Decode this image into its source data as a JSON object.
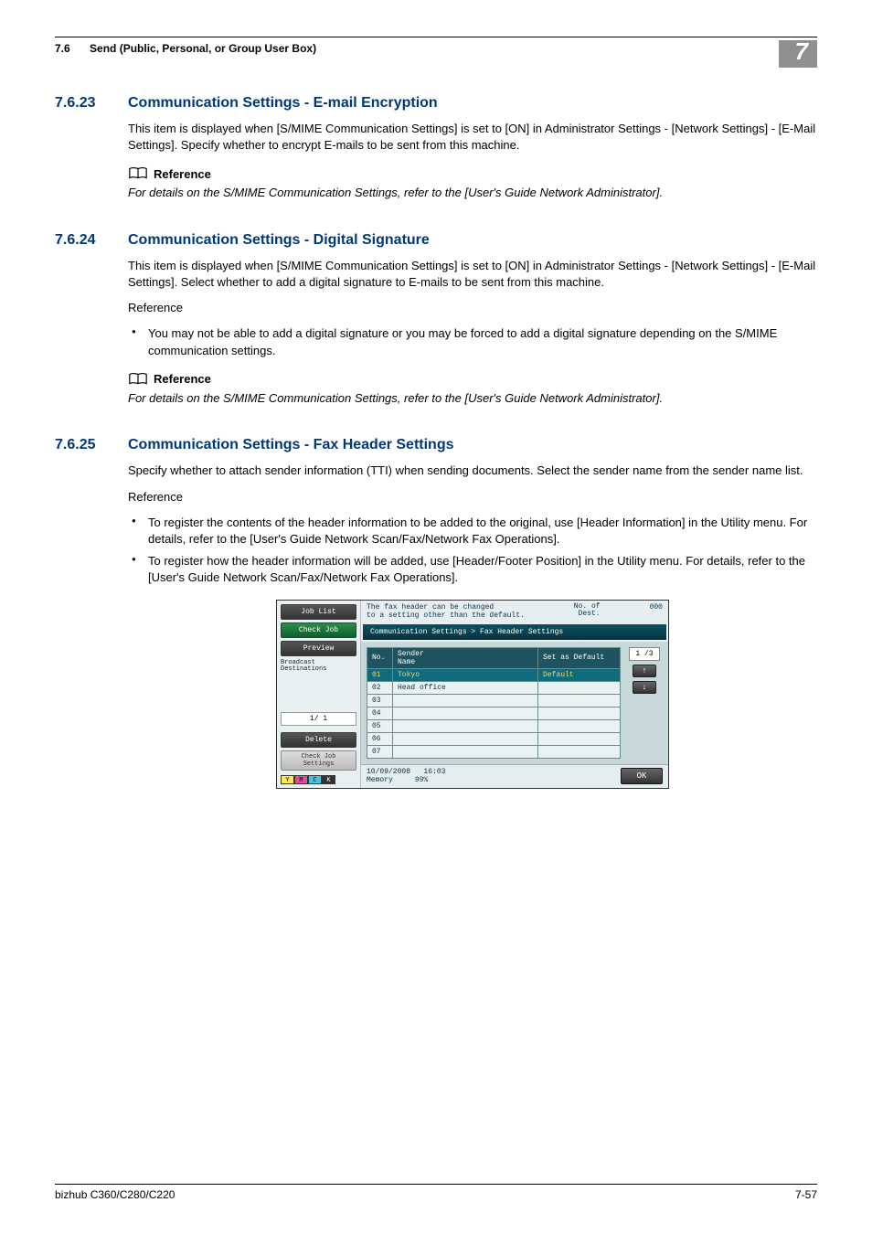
{
  "header": {
    "section_num": "7.6",
    "section_title": "Send (Public, Personal, or Group User Box)",
    "chapter_badge": "7"
  },
  "s1": {
    "num": "7.6.23",
    "title": "Communication Settings - E-mail Encryption",
    "p1": "This item is displayed when [S/MIME Communication Settings] is set to [ON] in Administrator Settings - [Network Settings] - [E-Mail Settings]. Specify whether to encrypt E-mails to be sent from this machine.",
    "ref_label": "Reference",
    "ref_text": "For details on the S/MIME Communication Settings, refer to the [User's Guide Network Administrator]."
  },
  "s2": {
    "num": "7.6.24",
    "title": "Communication Settings - Digital Signature",
    "p1": "This item is displayed when [S/MIME Communication Settings] is set to [ON] in Administrator Settings - [Network Settings] - [E-Mail Settings]. Select whether to add a digital signature to E-mails to be sent from this machine.",
    "plain_ref": "Reference",
    "bullet1": "You may not be able to add a digital signature or you may be forced to add a digital signature depending on the S/MIME communication settings.",
    "ref_label": "Reference",
    "ref_text": "For details on the S/MIME Communication Settings, refer to the [User's Guide Network Administrator]."
  },
  "s3": {
    "num": "7.6.25",
    "title": "Communication Settings - Fax Header Settings",
    "p1": "Specify whether to attach sender information (TTI) when sending documents. Select the sender name from the sender name list.",
    "plain_ref": "Reference",
    "bullet1": "To register the contents of the header information to be added to the original, use [Header Information] in the Utility menu. For details, refer to the [User's Guide Network Scan/Fax/Network Fax Operations].",
    "bullet2": "To register how the header information will be added, use [Header/Footer Position] in the Utility menu. For details, refer to the [User's Guide Network Scan/Fax/Network Fax Operations]."
  },
  "ui": {
    "left": {
      "job_list": "Job List",
      "check_job": "Check Job",
      "preview": "Preview",
      "broadcast": "Broadcast\nDestinations",
      "page": "1/  1",
      "delete": "Delete",
      "check_settings": "Check Job\nSettings",
      "y": "Y",
      "m": "M",
      "c": "C",
      "k": "K"
    },
    "top_msg": "The fax header can be changed\nto a setting other than the default.",
    "dest_label": "No. of\nDest.",
    "dest_count": "000",
    "breadcrumb": "Communication Settings > Fax Header Settings",
    "cols": {
      "no": "No.",
      "name": "Sender\nName",
      "def": "Set as Default"
    },
    "rows": [
      {
        "no": "01",
        "name": "Tokyo",
        "def": "Default"
      },
      {
        "no": "02",
        "name": "Head office",
        "def": ""
      },
      {
        "no": "03",
        "name": "",
        "def": ""
      },
      {
        "no": "04",
        "name": "",
        "def": ""
      },
      {
        "no": "05",
        "name": "",
        "def": ""
      },
      {
        "no": "06",
        "name": "",
        "def": ""
      },
      {
        "no": "07",
        "name": "",
        "def": ""
      }
    ],
    "page_ind": "1 /3",
    "up": "↑",
    "down": "↓",
    "date": "10/09/2008",
    "time": "16:03",
    "memory_l": "Memory",
    "memory_v": "99%",
    "ok": "OK"
  },
  "footer": {
    "model": "bizhub C360/C280/C220",
    "page": "7-57"
  }
}
